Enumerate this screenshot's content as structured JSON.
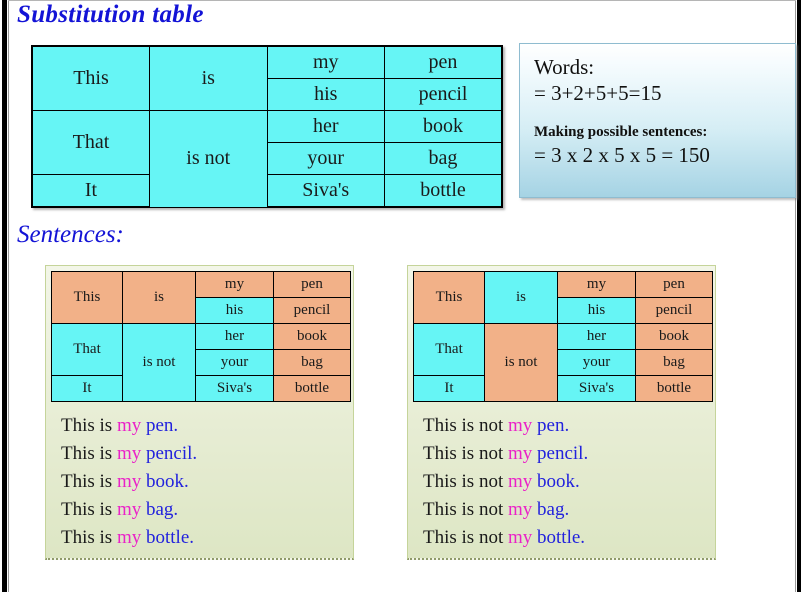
{
  "slide": {
    "title": "Substitution table",
    "subtitle": "Sentences:"
  },
  "main_table": {
    "rows": [
      {
        "subject": "This",
        "verb": "is",
        "possessive": "my",
        "object": "pen"
      },
      {
        "subject": "",
        "verb": "",
        "possessive": "his",
        "object": "pencil"
      },
      {
        "subject": "That",
        "verb": "is not",
        "possessive": "her",
        "object": "book"
      },
      {
        "subject": "",
        "verb": "",
        "possessive": "your",
        "object": "bag"
      },
      {
        "subject": "It",
        "verb": "",
        "possessive": "Siva's",
        "object": "bottle"
      }
    ],
    "cells": {
      "subject_this": "This",
      "subject_that": "That",
      "subject_it": "It",
      "verb_is": "is",
      "verb_is_not": "is not",
      "poss_my": "my",
      "poss_his": "his",
      "poss_her": "her",
      "poss_your": "your",
      "poss_sivas": "Siva's",
      "obj_pen": "pen",
      "obj_pencil": "pencil",
      "obj_book": "book",
      "obj_bag": "bag",
      "obj_bottle": "bottle"
    }
  },
  "info_box": {
    "words_label": "Words:",
    "words_sum": "= 3+2+5+5=15",
    "sentences_label": "Making possible sentences:",
    "sentences_product": "= 3 x 2 x 5 x 5 = 150"
  },
  "panels": [
    {
      "id": "affirmative",
      "highlight": {
        "subject_this": "orange",
        "subject_that": "cyan",
        "subject_it": "cyan",
        "verb_is": "orange",
        "verb_is_not": "cyan",
        "poss_my": "orange",
        "poss_his": "cyan",
        "poss_her": "cyan",
        "poss_your": "cyan",
        "poss_sivas": "cyan",
        "obj_pen": "orange",
        "obj_pencil": "orange",
        "obj_book": "orange",
        "obj_bag": "orange",
        "obj_bottle": "orange"
      },
      "sentences": [
        {
          "subject": "This is ",
          "possessive": "my ",
          "object": "pen."
        },
        {
          "subject": "This is ",
          "possessive": "my ",
          "object": "pencil."
        },
        {
          "subject": "This is ",
          "possessive": "my ",
          "object": "book."
        },
        {
          "subject": "This is ",
          "possessive": "my ",
          "object": "bag."
        },
        {
          "subject": "This is ",
          "possessive": "my ",
          "object": "bottle."
        }
      ]
    },
    {
      "id": "negative",
      "highlight": {
        "subject_this": "orange",
        "subject_that": "cyan",
        "subject_it": "cyan",
        "verb_is": "cyan",
        "verb_is_not": "orange",
        "poss_my": "orange",
        "poss_his": "cyan",
        "poss_her": "cyan",
        "poss_your": "cyan",
        "poss_sivas": "cyan",
        "obj_pen": "orange",
        "obj_pencil": "orange",
        "obj_book": "orange",
        "obj_bag": "orange",
        "obj_bottle": "orange"
      },
      "sentences": [
        {
          "subject": "This is not ",
          "possessive": "my ",
          "object": "pen."
        },
        {
          "subject": "This is not ",
          "possessive": "my ",
          "object": "pencil."
        },
        {
          "subject": "This is not ",
          "possessive": "my ",
          "object": "book."
        },
        {
          "subject": "This is not ",
          "possessive": "my ",
          "object": "bag."
        },
        {
          "subject": "This is not ",
          "possessive": "my ",
          "object": "bottle."
        }
      ]
    }
  ],
  "colors": {
    "heading": "#1313d6",
    "cyan": "#66f5f5",
    "orange": "#f2b188",
    "possessive_text": "#ea22c8",
    "object_text": "#2222dd",
    "panel_bg": "#e6ecd2",
    "info_bg": "#a5d3e4"
  }
}
